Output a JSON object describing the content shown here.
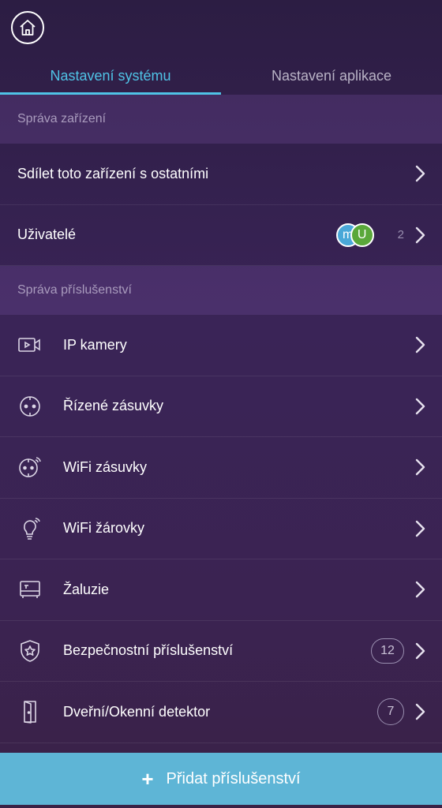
{
  "header": {
    "home_icon": "home-icon"
  },
  "tabs": [
    {
      "label": "Nastavení systému",
      "active": true
    },
    {
      "label": "Nastavení aplikace",
      "active": false
    }
  ],
  "device_section": {
    "title": "Správa zařízení",
    "share_label": "Sdílet toto zařízení s ostatními",
    "users_label": "Uživatelé",
    "users_avatars": [
      "m",
      "U"
    ],
    "users_count": "2"
  },
  "accessory_section": {
    "title": "Správa příslušenství",
    "items": [
      {
        "label": "IP kamery",
        "icon": "camera-icon",
        "badge": ""
      },
      {
        "label": "Řízené zásuvky",
        "icon": "socket-icon",
        "badge": ""
      },
      {
        "label": "WiFi zásuvky",
        "icon": "wifi-socket-icon",
        "badge": ""
      },
      {
        "label": "WiFi žárovky",
        "icon": "bulb-icon",
        "badge": ""
      },
      {
        "label": "Žaluzie",
        "icon": "blinds-icon",
        "badge": ""
      },
      {
        "label": "Bezpečnostní příslušenství",
        "icon": "shield-icon",
        "badge": "12"
      },
      {
        "label": "Dveřní/Okenní detektor",
        "icon": "door-icon",
        "badge": "7"
      }
    ]
  },
  "footer": {
    "add_label": "Přidat příslušenství",
    "plus_symbol": "+"
  },
  "colors": {
    "accent": "#4fc3e6",
    "bottom_bar": "#5eb5d6",
    "background": "#3a2457"
  }
}
